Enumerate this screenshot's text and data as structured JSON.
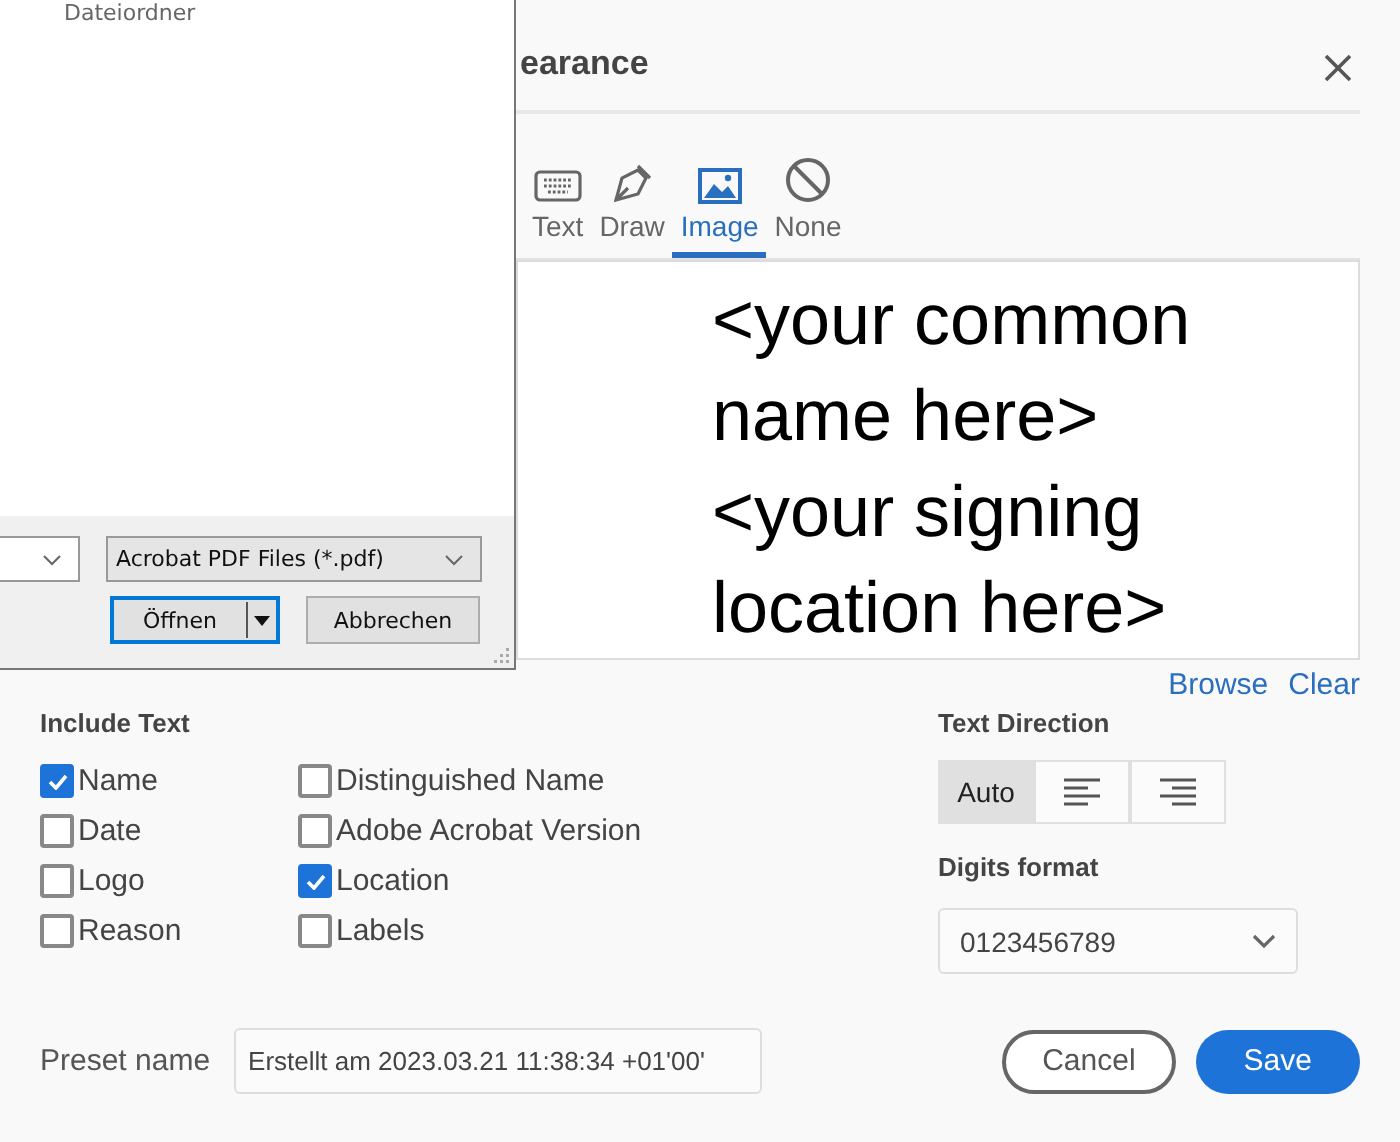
{
  "file_dialog": {
    "folder_type": "Dateiordner",
    "filetype": "Acrobat PDF Files (*.pdf)",
    "buttons": [
      {
        "label": "Öffnen",
        "kind": "split",
        "focused": true
      },
      {
        "label": "Abbrechen",
        "kind": "plain",
        "focused": false
      }
    ]
  },
  "dialog": {
    "title": "earance",
    "tabs": [
      {
        "label": "Text",
        "kind": "keyboard",
        "selected": false
      },
      {
        "label": "Draw",
        "kind": "pen",
        "selected": false
      },
      {
        "label": "Image",
        "kind": "image",
        "selected": true
      },
      {
        "label": "None",
        "kind": "none",
        "selected": false
      }
    ],
    "preview_lines": [
      "<your common",
      "name here>",
      "<your signing",
      "location here>"
    ],
    "links": [
      "Browse",
      "Clear"
    ],
    "include_text": {
      "title": "Include Text",
      "options": [
        {
          "label": "Name",
          "checked": true
        },
        {
          "label": "Date",
          "checked": false
        },
        {
          "label": "Logo",
          "checked": false
        },
        {
          "label": "Reason",
          "checked": false
        },
        {
          "label": "Distinguished Name",
          "checked": false
        },
        {
          "label": "Adobe Acrobat Version",
          "checked": false
        },
        {
          "label": "Location",
          "checked": true
        },
        {
          "label": "Labels",
          "checked": false
        }
      ]
    },
    "text_direction": {
      "title": "Text Direction",
      "options": [
        {
          "kind": "text",
          "label": "Auto",
          "selected": true
        },
        {
          "kind": "align-left",
          "selected": false
        },
        {
          "kind": "align-right",
          "selected": false
        }
      ]
    },
    "digits_format": {
      "title": "Digits format",
      "value": "0123456789"
    },
    "preset": {
      "label": "Preset name",
      "value": "Erstellt am 2023.03.21 11:38:34 +01'00'"
    },
    "buttons": [
      {
        "label": "Cancel",
        "kind": "secondary"
      },
      {
        "label": "Save",
        "kind": "primary"
      }
    ]
  }
}
